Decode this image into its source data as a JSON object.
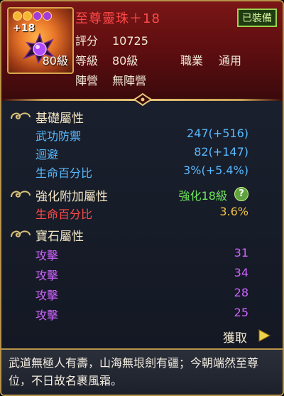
{
  "item": {
    "icon": "purple-orb-icon",
    "plus_level": "+18",
    "level_tag": "80級",
    "name": "至尊靈珠＋18",
    "equipped": "已裝備",
    "gem_colors": [
      "#f5b731",
      "#f5b731",
      "#a33cd8",
      "#a33cd8"
    ]
  },
  "info": {
    "score_label": "評分",
    "score_value": "10725",
    "level_label": "等級",
    "level_value": "80級",
    "class_label": "職業",
    "class_value": "通用",
    "faction_label": "陣營",
    "faction_value": "無陣營"
  },
  "base_attrs": {
    "title": "基礎屬性",
    "rows": [
      {
        "name": "武功防禦",
        "value": "247(+516)"
      },
      {
        "name": "迴避",
        "value": "82(+147)"
      },
      {
        "name": "生命百分比",
        "value": "3%(+5.4%)"
      }
    ]
  },
  "enhance": {
    "title": "強化附加屬性",
    "level": "強化18級",
    "help": "?",
    "rows": [
      {
        "name": "生命百分比",
        "value": "3.6%"
      }
    ]
  },
  "gems": {
    "title": "寶石屬性",
    "rows": [
      {
        "name": "攻擊",
        "value": "31"
      },
      {
        "name": "攻擊",
        "value": "34"
      },
      {
        "name": "攻擊",
        "value": "28"
      },
      {
        "name": "攻擊",
        "value": "25"
      }
    ]
  },
  "obtain": "獲取",
  "description": "武道無極人有壽，山海無垠劍有疆；今朝端然至尊位，不日故名裹風霜。",
  "colors": {
    "name": "#ff4a4a",
    "base_attr": "#58b9ff",
    "enhance_attr": "#f0c143",
    "enhance_level": "#6ee35c",
    "gem_attr": "#cf63ff",
    "frame": "#b8934a"
  }
}
